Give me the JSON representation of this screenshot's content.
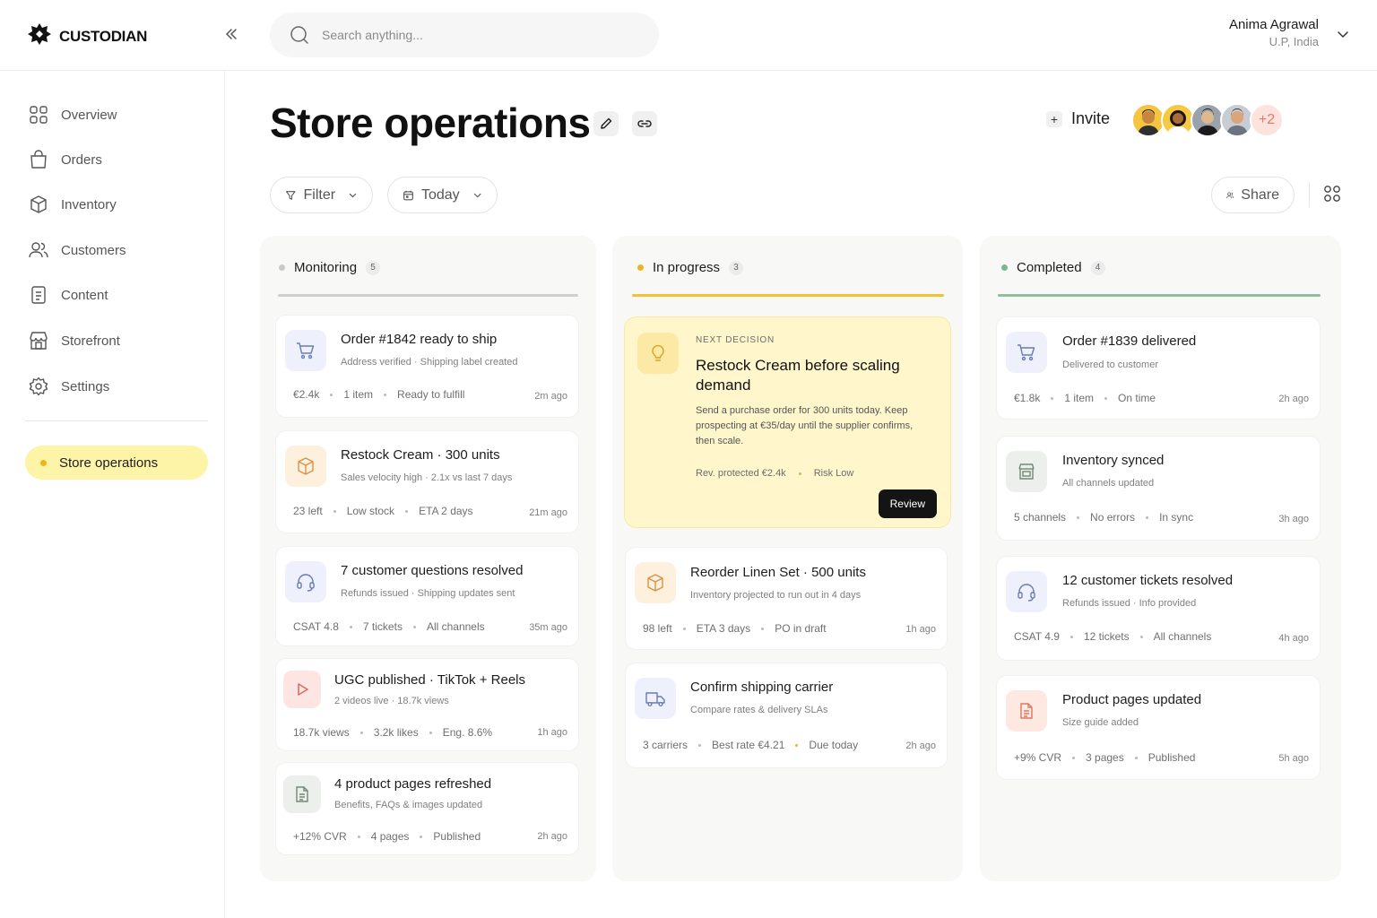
{
  "brand": {
    "name": "CUSTODIAN"
  },
  "search": {
    "placeholder": "Search anything..."
  },
  "user": {
    "name": "Anima Agrawal",
    "location": "U.P, India"
  },
  "sidebar": {
    "items": [
      {
        "label": "Overview",
        "icon": "grid-icon"
      },
      {
        "label": "Orders",
        "icon": "shopping-bag-icon"
      },
      {
        "label": "Inventory",
        "icon": "box-icon"
      },
      {
        "label": "Customers",
        "icon": "users-icon"
      },
      {
        "label": "Content",
        "icon": "document-icon"
      },
      {
        "label": "Storefront",
        "icon": "store-icon"
      },
      {
        "label": "Settings",
        "icon": "gear-icon"
      }
    ],
    "active": {
      "label": "Store operations"
    }
  },
  "header": {
    "title": "Store operations",
    "invite_label": "Invite",
    "more_avatars": "+2",
    "filter_label": "Filter",
    "date_label": "Today",
    "share_label": "Share"
  },
  "colors": {
    "accent_yellow": "#fdf4a8",
    "monitoring": "#c9c9c9",
    "in_progress": "#f0b41a",
    "completed": "#7fb48f"
  },
  "columns": {
    "monitoring": {
      "title": "Monitoring",
      "count": "5",
      "cards": [
        {
          "title": "Order #1842 ready to ship",
          "sub": "Address verified · Shipping label created",
          "meta": [
            "€2.4k",
            "1 item",
            "Ready to fulfill"
          ],
          "time": "2m ago",
          "icon": "cart-icon"
        },
        {
          "title": "Restock Cream · 300 units",
          "sub": "Sales velocity high · 2.1x vs last 7 days",
          "meta": [
            "23 left",
            "Low stock",
            "ETA 2 days"
          ],
          "time": "21m ago",
          "icon": "box-icon"
        },
        {
          "title": "7 customer questions resolved",
          "sub": "Refunds issued · Shipping updates sent",
          "meta": [
            "CSAT 4.8",
            "7 tickets",
            "All channels"
          ],
          "time": "35m ago",
          "icon": "headset-icon"
        },
        {
          "title": "UGC published · TikTok + Reels",
          "sub": "2 videos live · 18.7k views",
          "meta": [
            "18.7k views",
            "3.2k likes",
            "Eng. 8.6%"
          ],
          "time": "1h ago",
          "icon": "play-icon"
        },
        {
          "title": "4 product pages refreshed",
          "sub": "Benefits, FAQs & images updated",
          "meta": [
            "+12% CVR",
            "4 pages",
            "Published"
          ],
          "time": "2h ago",
          "icon": "document-icon"
        }
      ]
    },
    "in_progress": {
      "title": "In progress",
      "count": "3",
      "highlight": {
        "kicker": "NEXT DECISION",
        "title": "Restock Cream before scaling demand",
        "body": "Send a purchase order for 300 units today. Keep prospecting at €35/day until the supplier confirms, then scale.",
        "meta": [
          "Rev. protected €2.4k",
          "Risk Low"
        ],
        "button": "Review",
        "icon": "lightbulb-icon"
      },
      "cards": [
        {
          "title": "Reorder Linen Set · 500 units",
          "sub": "Inventory projected to run out in 4 days",
          "meta": [
            "98 left",
            "ETA 3 days",
            "PO in draft"
          ],
          "time": "1h ago",
          "icon": "box-icon"
        },
        {
          "title": "Confirm shipping carrier",
          "sub": "Compare rates & delivery SLAs",
          "meta": [
            "3 carriers",
            "Best rate €4.21",
            "Due today"
          ],
          "time": "2h ago",
          "icon": "truck-icon"
        }
      ]
    },
    "completed": {
      "title": "Completed",
      "count": "4",
      "cards": [
        {
          "title": "Order #1839 delivered",
          "sub": "Delivered to customer",
          "meta": [
            "€1.8k",
            "1 item",
            "On time"
          ],
          "time": "2h ago",
          "icon": "cart-icon"
        },
        {
          "title": "Inventory synced",
          "sub": "All channels updated",
          "meta": [
            "5 channels",
            "No errors",
            "In sync"
          ],
          "time": "3h ago",
          "icon": "store-icon"
        },
        {
          "title": "12 customer tickets resolved",
          "sub": "Refunds issued · Info provided",
          "meta": [
            "CSAT 4.9",
            "12 tickets",
            "All channels"
          ],
          "time": "4h ago",
          "icon": "headset-icon"
        },
        {
          "title": "Product pages updated",
          "sub": "Size guide added",
          "meta": [
            "+9% CVR",
            "3 pages",
            "Published"
          ],
          "time": "5h ago",
          "icon": "document-icon"
        }
      ]
    }
  }
}
